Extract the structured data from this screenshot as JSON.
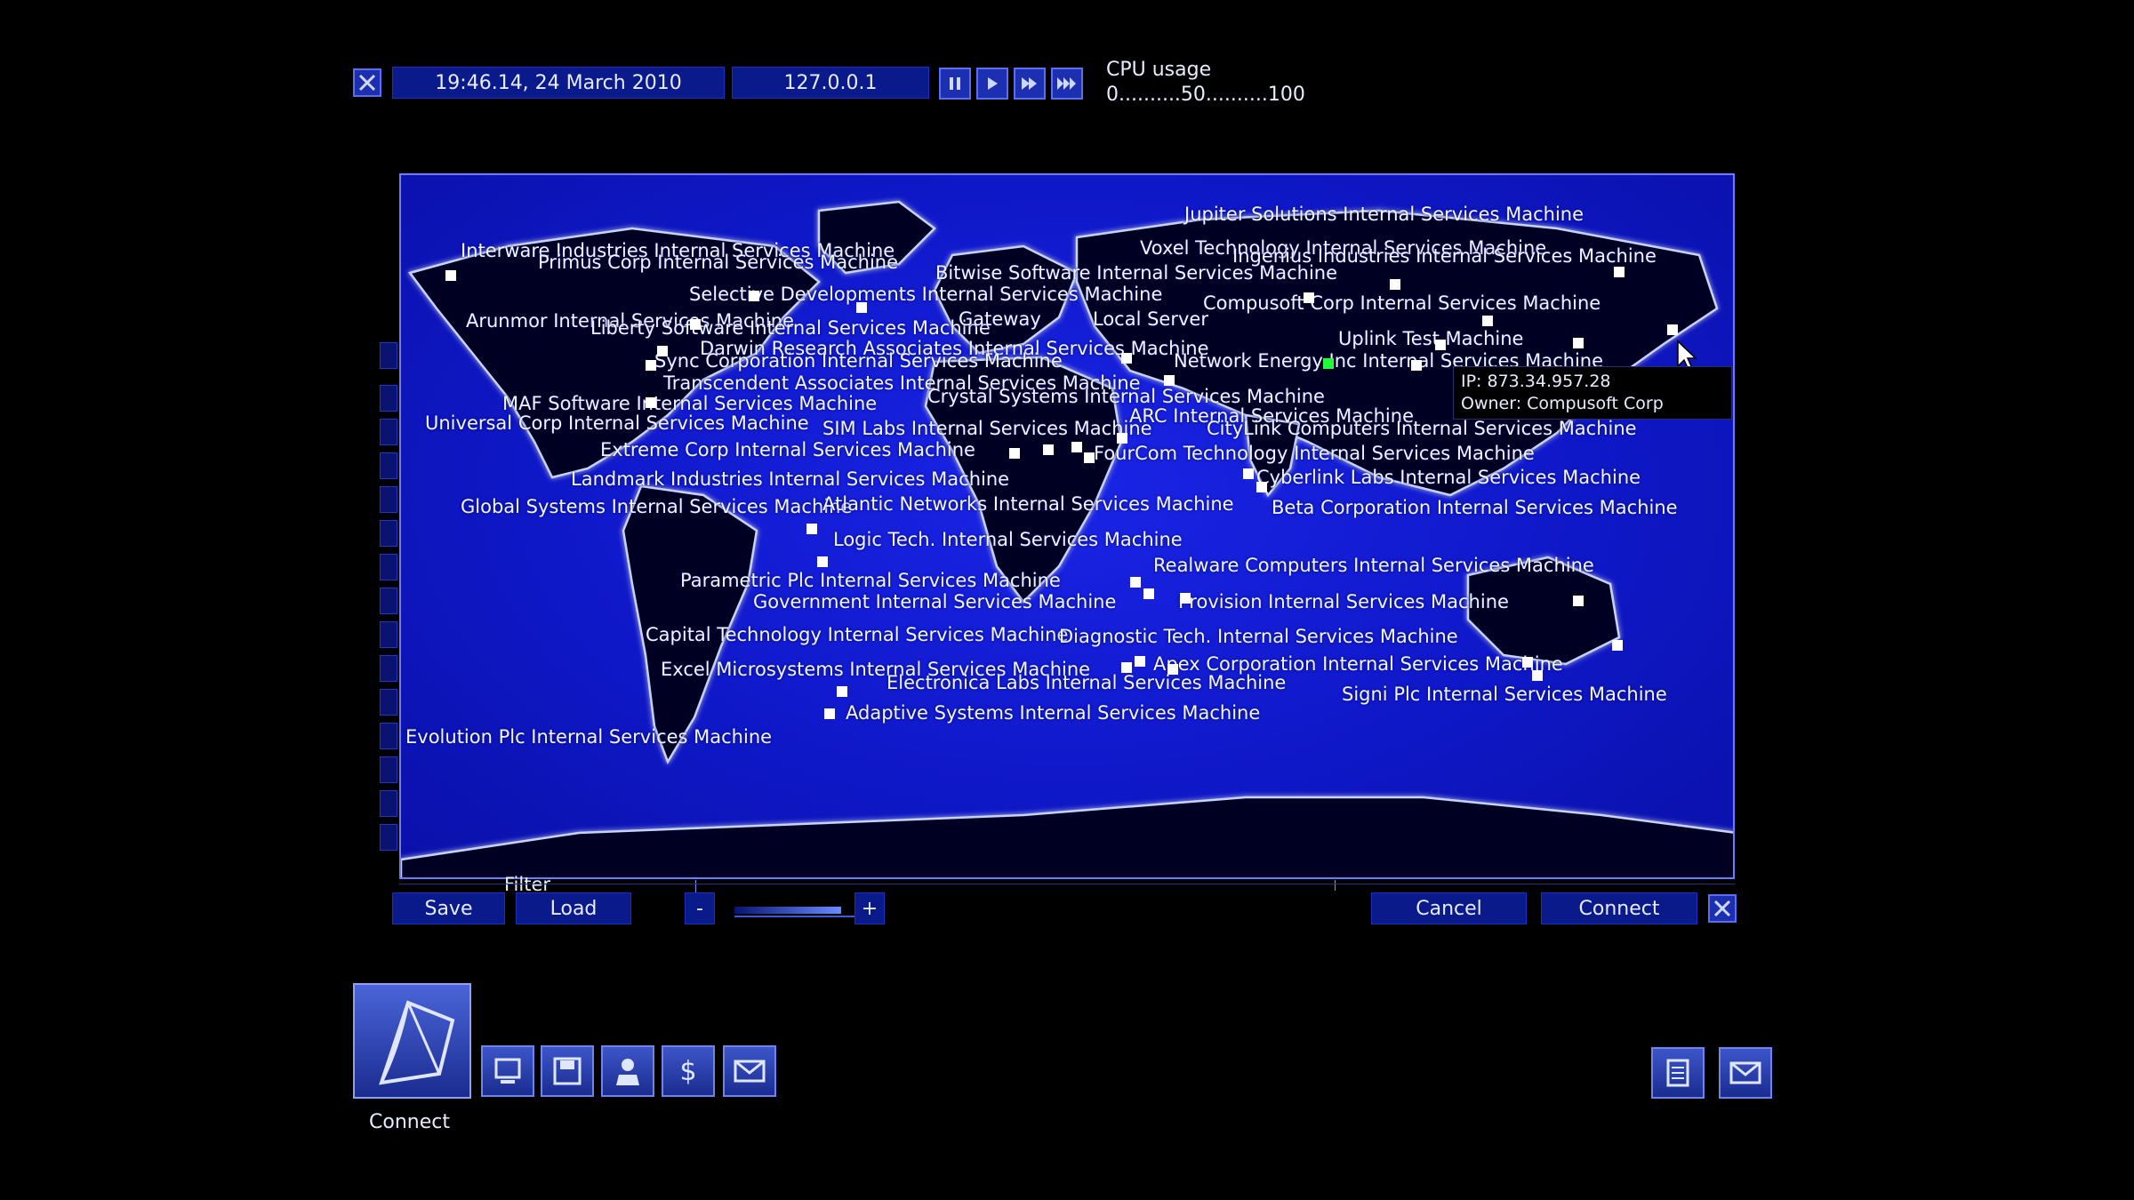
{
  "topbar": {
    "datetime": "19:46.14, 24 March 2010",
    "ip": "127.0.0.1",
    "cpu_title": "CPU usage",
    "cpu_scale": "0..........50..........100"
  },
  "map": {
    "labels": [
      "Jupiter Solutions Internal Services Machine",
      "Interware Industries Internal Services Machine",
      "Primus Corp Internal Services Machine",
      "Voxel Technology Internal Services Machine",
      "Ingenius Industries Internal Services Machine",
      "Bitwise Software Internal Services Machine",
      "Selective Developments Internal Services Machine",
      "Compusoft Corp Internal Services Machine",
      "Arunmor Internal Services Machine",
      "Liberty Software Internal Services Machine",
      "Gateway",
      "Local Server",
      "Uplink Test Machine",
      "Darwin Research Associates Internal Services Machine",
      "Sync Corporation Internal Services Machine",
      "Network Energy Inc Internal Services Machine",
      "Transcendent Associates Internal Services Machine",
      "MAF Software Internal Services Machine",
      "Crystal Systems Internal Services Machine",
      "Universal Corp Internal Services Machine",
      "ARC Internal Services Machine",
      "SIM Labs Internal Services Machine",
      "CityLink Computers Internal Services Machine",
      "Extreme Corp Internal Services Machine",
      "FourCom Technology Internal Services Machine",
      "Landmark Industries Internal Services Machine",
      "Cyberlink Labs Internal Services Machine",
      "Global Systems Internal Services Machine",
      "Atlantic Networks Internal Services Machine",
      "Beta Corporation Internal Services Machine",
      "Logic Tech. Internal Services Machine",
      "Realware Computers Internal Services Machine",
      "Parametric Plc Internal Services Machine",
      "Government Internal Services Machine",
      "Provision Internal Services Machine",
      "Capital Technology Internal Services Machine",
      "Diagnostic Tech. Internal Services Machine",
      "Excel Microsystems Internal Services Machine",
      "Apex Corporation Internal Services Machine",
      "Electronica Labs Internal Services Machine",
      "Signi Plc Internal Services Machine",
      "Adaptive Systems Internal Services Machine",
      "Evolution Plc Internal Services Machine"
    ],
    "tooltip": {
      "ip": "IP: 873.34.957.28",
      "owner": "Owner: Compusoft Corp"
    }
  },
  "controls": {
    "filter_label": "Filter",
    "save": "Save",
    "load": "Load",
    "zoom_minus": "-",
    "zoom_plus": "+",
    "cancel": "Cancel",
    "connect": "Connect"
  },
  "bottom": {
    "connect_label": "Connect"
  },
  "colors": {
    "map_blue": "#1020d0",
    "node_active": "#1fff3a",
    "button_blue": "#0b1a8a"
  }
}
